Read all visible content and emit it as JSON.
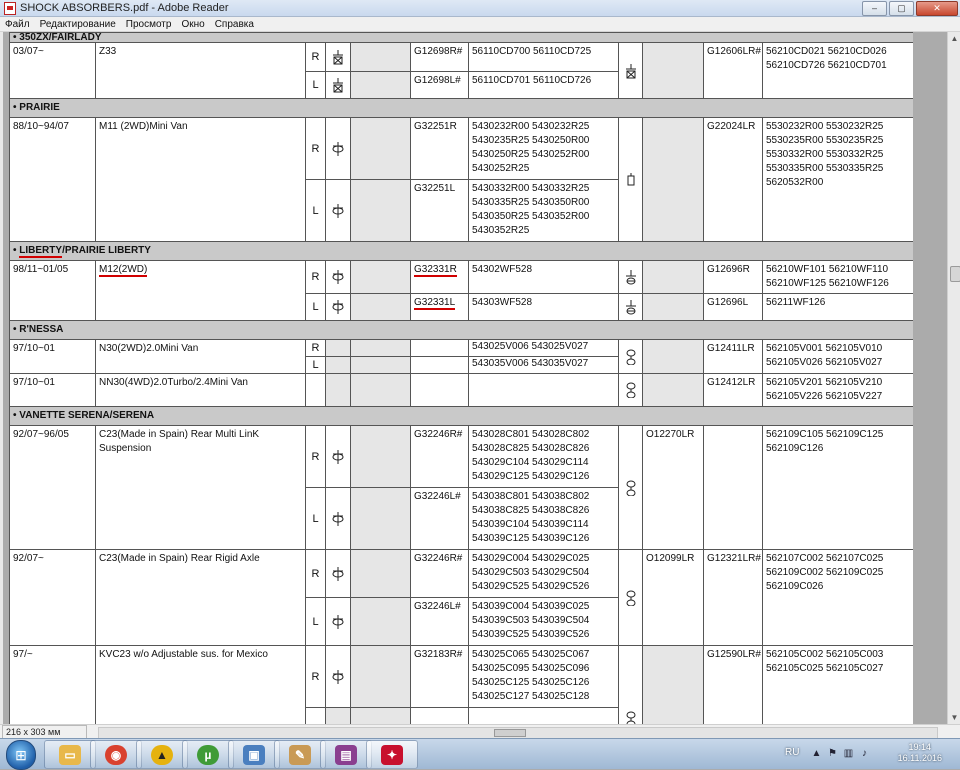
{
  "window": {
    "title": "SHOCK ABSORBERS.pdf - Adobe Reader",
    "min": "–",
    "max": "▢",
    "close": "✕"
  },
  "menu": [
    "Файл",
    "Редактирование",
    "Просмотр",
    "Окно",
    "Справка"
  ],
  "sections": [
    {
      "title": "• 350ZX/FAIRLADY"
    },
    {
      "title": "• PRAIRIE"
    },
    {
      "title_parts": [
        "LIBERTY",
        "/PRAIRIE LIBERTY"
      ]
    },
    {
      "title": "• R'NESSA"
    },
    {
      "title": "• VANETTE SERENA/SERENA"
    }
  ],
  "rows": [
    {
      "date": "03/07~",
      "model": "Z33",
      "right": {
        "side": "R",
        "code": "G12698R#",
        "oem": "56110CD700  56110CD725"
      },
      "left": {
        "side": "L",
        "code": "G12698L#",
        "oem": "56110CD701  56110CD726"
      },
      "rear_code": "G12606LR#",
      "rear_oem": "56210CD021  56210CD026\n56210CD726  56210CD701"
    },
    {
      "date": "88/10~94/07",
      "model": "M11 (2WD)Mini Van",
      "right": {
        "side": "R",
        "code": "G32251R",
        "oem": "5430232R00  5430232R25\n5430235R25  5430250R00\n5430250R25  5430252R00\n5430252R25"
      },
      "left": {
        "side": "L",
        "code": "G32251L",
        "oem": "5430332R00  5430332R25\n5430335R25  5430350R00\n5430350R25  5430352R00\n5430352R25"
      },
      "rear_code": "G22024LR",
      "rear_oem": "5530232R00  5530232R25\n5530235R00  5530235R25\n5530332R00  5530332R25\n5530335R00  5530335R25\n5620532R00"
    },
    {
      "date": "98/11~01/05",
      "model": "M12(2WD)",
      "right": {
        "side": "R",
        "code": "G32331R",
        "oem": "54302WF528",
        "rear_code": "G12696R",
        "rear_oem": "56210WF101  56210WF110\n56210WF125  56210WF126"
      },
      "left": {
        "side": "L",
        "code": "G32331L",
        "oem": "54303WF528",
        "rear_code": "G12696L",
        "rear_oem": "56211WF126"
      }
    },
    {
      "date": "97/10~01",
      "model": "N30(2WD)2.0Mini Van",
      "right": {
        "side": "R",
        "oem": "543025V006  543025V027"
      },
      "left": {
        "side": "L",
        "oem": "543035V006  543035V027"
      },
      "rear_code": "G12411LR",
      "rear_oem": "562105V001  562105V010\n562105V026  562105V027"
    },
    {
      "date": "97/10~01",
      "model": "NN30(4WD)2.0Turbo/2.4Mini Van",
      "rear_code": "G12412LR",
      "rear_oem": "562105V201  562105V210\n562105V226  562105V227"
    },
    {
      "date": "92/07~96/05",
      "model": "C23(Made in Spain) Rear Multi LinK Suspension",
      "right": {
        "side": "R",
        "code": "G32246R#",
        "oem": "543028C801  543028C802\n543028C825  543028C826\n543029C104  543029C114\n543029C125  543029C126"
      },
      "left": {
        "side": "L",
        "code": "G32246L#",
        "oem": "543038C801  543038C802\n543038C825  543038C826\n543039C104  543039C114\n543039C125  543039C126"
      },
      "mid_code": "O12270LR",
      "rear_oem": "562109C105  562109C125\n562109C126"
    },
    {
      "date": "92/07~",
      "model": "C23(Made in Spain) Rear Rigid Axle",
      "right": {
        "side": "R",
        "code": "G32246R#",
        "oem": "543029C004  543029C025\n543029C503  543029C504\n543029C525  543029C526"
      },
      "left": {
        "side": "L",
        "code": "G32246L#",
        "oem": "543039C004  543039C025\n543039C503  543039C504\n543039C525  543039C526"
      },
      "mid_code": "O12099LR",
      "rear_code": "G12321LR#",
      "rear_oem": "562107C002  562107C025\n562109C002  562109C025\n562109C026"
    },
    {
      "date": "97/~",
      "model": "KVC23 w/o Adjustable sus. for Mexico",
      "right": {
        "side": "R",
        "code": "G32183R#",
        "oem": "543025C065  543025C067\n543025C095  543025C096\n543025C125  543025C126\n543025C127  543025C128"
      },
      "rear_code": "G12590LR#",
      "rear_oem": "562105C002  562105C003\n562105C025  562105C027"
    }
  ],
  "status": {
    "page_size": "216 x 303 мм"
  },
  "taskbar": {
    "start_glyph": "⊞",
    "apps": [
      {
        "name": "explorer",
        "glyph": "▭",
        "color": "#e8b84a"
      },
      {
        "name": "chrome",
        "glyph": "◉",
        "color": "#d9412f"
      },
      {
        "name": "app-yellow",
        "glyph": "▲",
        "color": "#e5b20f"
      },
      {
        "name": "utorrent",
        "glyph": "µ",
        "color": "#3f9b37"
      },
      {
        "name": "image-viewer",
        "glyph": "▣",
        "color": "#4a7fbf"
      },
      {
        "name": "paint",
        "glyph": "✎",
        "color": "#c99a55"
      },
      {
        "name": "winrar",
        "glyph": "▤",
        "color": "#8a3f8f"
      },
      {
        "name": "adobe-reader",
        "glyph": "✦",
        "color": "#c8102e"
      }
    ],
    "lang": "RU",
    "time": "19:14",
    "date": "16.11.2016"
  }
}
